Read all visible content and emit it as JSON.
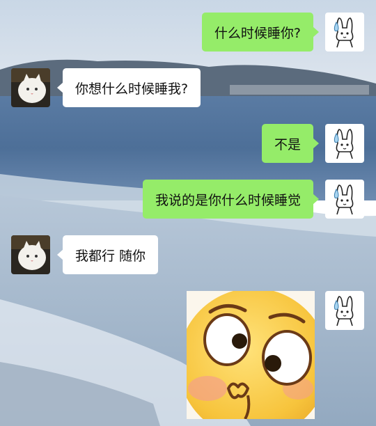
{
  "chat": {
    "messages": [
      {
        "side": "out",
        "text": "什么时候睡你?"
      },
      {
        "side": "in",
        "text": "你想什么时候睡我?"
      },
      {
        "side": "out",
        "text": "不是"
      },
      {
        "side": "out",
        "text": "我说的是你什么时候睡觉"
      },
      {
        "side": "in",
        "text": "我都行 随你"
      },
      {
        "side": "out",
        "sticker": "flushed-face-sticker"
      }
    ]
  },
  "avatars": {
    "self": "rabbit-sweat-icon",
    "other": "white-cat-icon"
  },
  "colors": {
    "outgoing_bubble": "#95ec69",
    "incoming_bubble": "#ffffff",
    "text": "#111111"
  }
}
